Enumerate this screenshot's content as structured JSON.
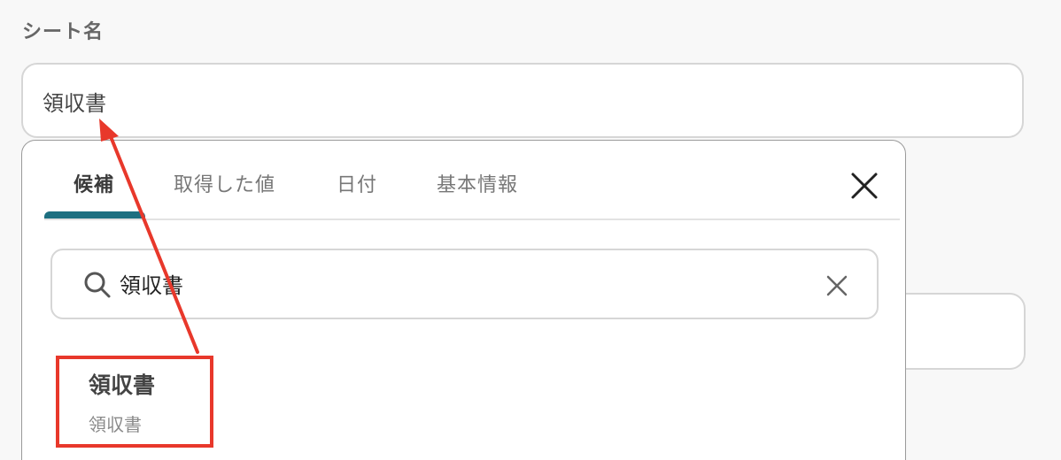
{
  "field": {
    "label": "シート名",
    "value": "領収書"
  },
  "popup": {
    "tabs": [
      {
        "label": "候補",
        "active": true
      },
      {
        "label": "取得した値",
        "active": false
      },
      {
        "label": "日付",
        "active": false
      },
      {
        "label": "基本情報",
        "active": false
      }
    ],
    "search": {
      "value": "領収書",
      "icon": "search-icon",
      "clear_icon": "close-icon"
    },
    "results": [
      {
        "title": "領収書",
        "subtitle": "領収書"
      }
    ],
    "close_icon": "close-icon"
  },
  "colors": {
    "accent": "#1d6f80",
    "highlight": "#e8382b",
    "border": "#d6d6d6"
  }
}
